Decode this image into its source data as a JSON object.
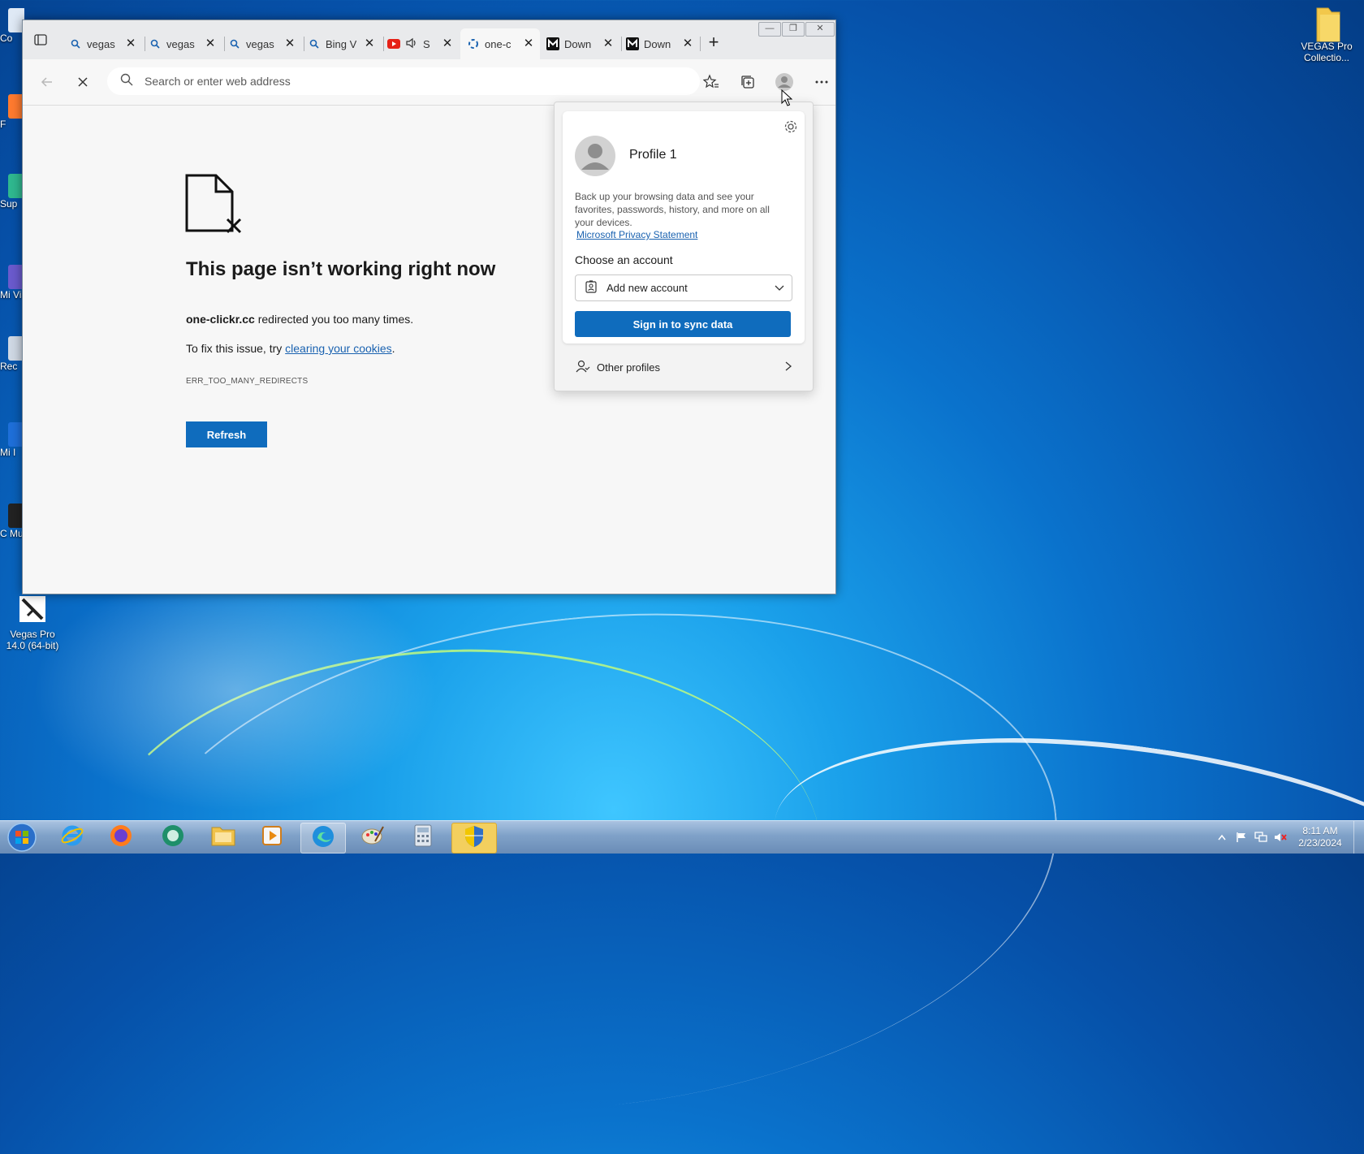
{
  "desktop": {
    "icon_right_label": "VEGAS Pro Collectio...",
    "icon_bottom_label": "Vegas Pro 14.0 (64-bit)",
    "stubs": [
      "Co",
      "F",
      "Sup",
      "Mi Visu",
      "Rec",
      "Mi I",
      "C Mu"
    ]
  },
  "browser": {
    "tabs": [
      {
        "label": "vegas",
        "icon": "search-icon"
      },
      {
        "label": "vegas",
        "icon": "search-icon"
      },
      {
        "label": "vegas",
        "icon": "search-icon"
      },
      {
        "label": "Bing V",
        "icon": "search-icon"
      },
      {
        "label": "S",
        "icon": "youtube-icon"
      },
      {
        "label": "one-c",
        "icon": "loading-icon"
      },
      {
        "label": "Down",
        "icon": "m-logo-icon"
      },
      {
        "label": "Down",
        "icon": "m-logo-icon"
      }
    ],
    "address_placeholder": "Search or enter web address"
  },
  "error_page": {
    "title": "This page isn’t working right now",
    "host": "one-clickr.cc",
    "message_tail": " redirected you too many times.",
    "fix_prefix": "To fix this issue, try ",
    "fix_link": "clearing your cookies",
    "fix_suffix": ".",
    "code": "ERR_TOO_MANY_REDIRECTS",
    "refresh_label": "Refresh"
  },
  "profile_flyout": {
    "name": "Profile 1",
    "description": "Back up your browsing data and see your favorites, passwords, history, and more on all your devices.",
    "privacy_link": "Microsoft Privacy Statement",
    "choose_label": "Choose an account",
    "account_select": "Add new account",
    "sync_button": "Sign in to sync data",
    "other_profiles": "Other profiles"
  },
  "taskbar": {
    "time": "8:11 AM",
    "date": "2/23/2024"
  },
  "colors": {
    "accent": "#0f6cbd",
    "link": "#1a62b0",
    "taskbar_highlight": "#f3cf5e"
  }
}
